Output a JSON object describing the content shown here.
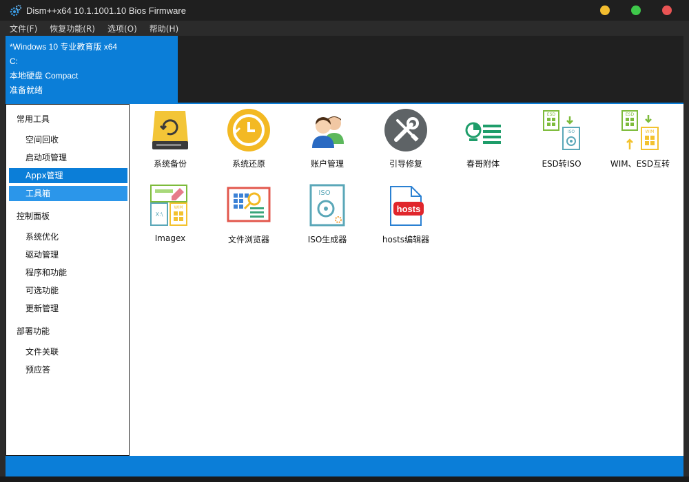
{
  "window": {
    "title": "Dism++x64 10.1.1001.10 Bios Firmware",
    "colors": {
      "accent": "#0b7ed8",
      "close": "#e95454",
      "minimize": "#f3bd2f",
      "maximize": "#3ec84a"
    }
  },
  "menubar": {
    "items": [
      "文件(F)",
      "恢复功能(R)",
      "选项(O)",
      "帮助(H)"
    ]
  },
  "session": {
    "os_name": "*Windows 10 专业教育版 x64",
    "drive": "C:",
    "disk_info": "本地硬盘 Compact",
    "status": "准备就绪"
  },
  "sidebar": {
    "groups": [
      {
        "label": "常用工具",
        "items": [
          "空间回收",
          "启动项管理",
          "Appx管理",
          "工具箱"
        ]
      },
      {
        "label": "控制面板",
        "items": [
          "系统优化",
          "驱动管理",
          "程序和功能",
          "可选功能",
          "更新管理"
        ]
      },
      {
        "label": "部署功能",
        "items": [
          "文件关联",
          "预应答"
        ]
      }
    ]
  },
  "tools": [
    {
      "label": "系统备份",
      "icon": "backup-drive-icon"
    },
    {
      "label": "系统还原",
      "icon": "restore-clock-icon"
    },
    {
      "label": "账户管理",
      "icon": "users-icon"
    },
    {
      "label": "引导修复",
      "icon": "wrench-screwdriver-icon"
    },
    {
      "label": "春哥附体",
      "icon": "list-settings-icon"
    },
    {
      "label": "ESD转ISO",
      "icon": "esd-to-iso-icon"
    },
    {
      "label": "WIM、ESD互转",
      "icon": "wim-esd-convert-icon"
    },
    {
      "label": "Imagex",
      "icon": "imagex-icon"
    },
    {
      "label": "文件浏览器",
      "icon": "file-browser-icon"
    },
    {
      "label": "ISO生成器",
      "icon": "iso-maker-icon"
    },
    {
      "label": "hosts编辑器",
      "icon": "hosts-editor-icon"
    }
  ],
  "icons": {
    "hosts_text": "hosts",
    "iso_text": "ISO",
    "esd_text": "ESD",
    "wim_text": "WIM"
  }
}
